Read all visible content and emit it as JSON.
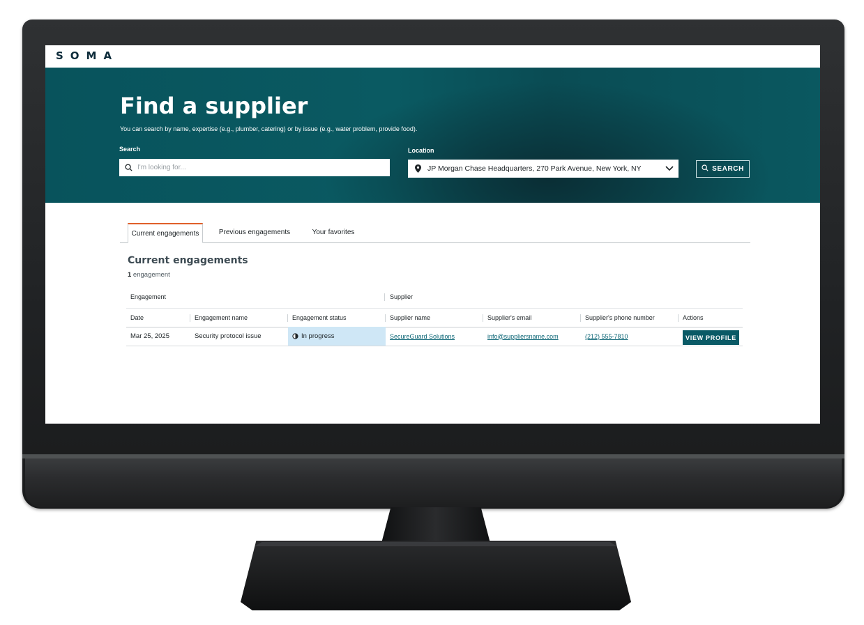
{
  "app": {
    "logo": "SOMA"
  },
  "hero": {
    "title": "Find a supplier",
    "subtitle": "You can search by name, expertise (e.g., plumber, catering) or by issue (e.g., water problem, provide food).",
    "search_label": "Search",
    "search_placeholder": "I'm looking for...",
    "search_value": "",
    "location_label": "Location",
    "location_value": "JP Morgan Chase Headquarters, 270 Park Avenue, New York, NY",
    "search_button": "SEARCH"
  },
  "tabs": [
    {
      "label": "Current engagements",
      "active": true
    },
    {
      "label": "Previous engagements",
      "active": false
    },
    {
      "label": "Your favorites",
      "active": false
    }
  ],
  "section": {
    "title": "Current engagements",
    "count": "1",
    "count_suffix": " engagement"
  },
  "table": {
    "groups": [
      "Engagement",
      "Supplier"
    ],
    "headers": [
      "Date",
      "Engagement name",
      "Engagement status",
      "Supplier name",
      "Supplier's email",
      "Supplier's phone number",
      "Actions"
    ],
    "rows": [
      {
        "date": "Mar 25, 2025",
        "name": "Security protocol issue",
        "status": "In progress",
        "supplier": "SecureGuard Solutions",
        "email": "info@suppliersname.com",
        "phone": "(212) 555-7810",
        "action": "VIEW PROFILE"
      }
    ]
  },
  "colors": {
    "hero_bg": "#0a5a62",
    "accent_tab": "#e0602a",
    "primary_button": "#0a5a66",
    "link": "#0b6575",
    "status_highlight": "#cfe7f6"
  },
  "icons": [
    "search-icon",
    "location-pin-icon",
    "chevron-down-icon",
    "half-circle-status-icon"
  ]
}
